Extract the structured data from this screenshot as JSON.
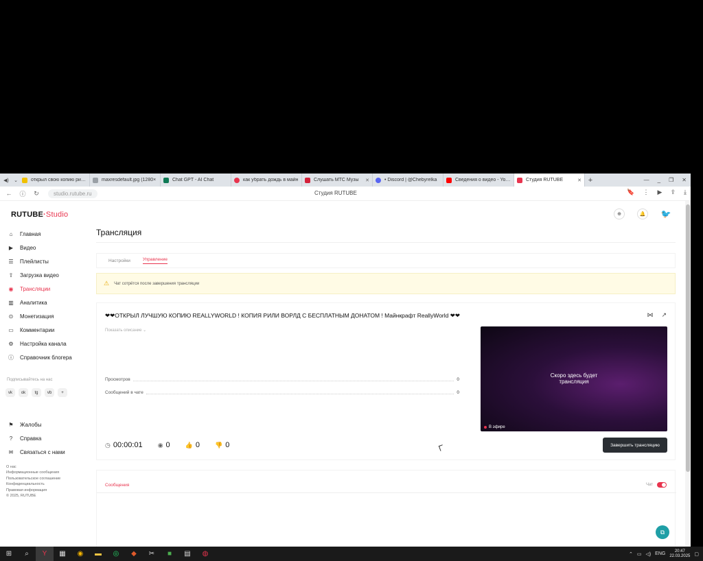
{
  "browser": {
    "tabs": [
      {
        "title": "открыл свою копию рилл",
        "color": "#f0c000"
      },
      {
        "title": "maxresdefault.jpg (1280×",
        "color": "#9aa0a6"
      },
      {
        "title": "Chat GPT - AI Chat",
        "color": "#0f7a55"
      },
      {
        "title": "как убрать дождь в майн",
        "color": "#e8344e"
      },
      {
        "title": "Слушать МТС Музы",
        "color": "#d4213a"
      },
      {
        "title": "• Discord | @Chebyrelka",
        "color": "#5865f2"
      },
      {
        "title": "Сведения о видео - YouT",
        "color": "#ff0000"
      },
      {
        "title": "Студия RUTUBE",
        "color": "#e8344e"
      }
    ],
    "url": "studio.rutube.ru",
    "page_title": "Студия RUTUBE"
  },
  "app": {
    "logo_main": "RUTUBE",
    "logo_studio": "Studio",
    "nav": [
      {
        "label": "Главная",
        "icon": "home-icon"
      },
      {
        "label": "Видео",
        "icon": "video-icon"
      },
      {
        "label": "Плейлисты",
        "icon": "playlist-icon"
      },
      {
        "label": "Загрузка видео",
        "icon": "upload-icon"
      },
      {
        "label": "Трансляции",
        "icon": "broadcast-icon",
        "active": true
      },
      {
        "label": "Аналитика",
        "icon": "analytics-icon"
      },
      {
        "label": "Монетизация",
        "icon": "money-icon"
      },
      {
        "label": "Комментарии",
        "icon": "comment-icon"
      },
      {
        "label": "Настройка канала",
        "icon": "gear-icon"
      },
      {
        "label": "Справочник блогера",
        "icon": "info-icon"
      }
    ],
    "subscribe_label": "Подписывайтесь на нас",
    "socials": [
      "vk",
      "ok",
      "tg",
      "vb",
      "+"
    ],
    "nav2": [
      {
        "label": "Жалобы",
        "icon": "flag-icon"
      },
      {
        "label": "Справка",
        "icon": "help-icon"
      },
      {
        "label": "Связаться с нами",
        "icon": "mail-icon"
      }
    ],
    "footer": [
      "О нас",
      "Информационные сообщения",
      "Пользовательское соглашение",
      "Конфиденциальность",
      "Правовая информация",
      "© 2025, RUTUBE"
    ]
  },
  "page": {
    "title": "Трансляция",
    "tabs": [
      "Настройки",
      "Управление"
    ],
    "active_tab": 1,
    "alert": "Чат сотрётся после завершения трансляции",
    "stream": {
      "title": "❤❤ОТКРЫЛ ЛУЧШУЮ КОПИЮ REALLYWORLD ! КОПИЯ РИЛИ ВОРЛД С БЕСПЛАТНЫМ ДОНАТОМ ! Майнкрафт ReallyWorld ❤❤",
      "show_description": "Показать описание ⌄",
      "stats": [
        {
          "label": "Просмотров",
          "value": "0"
        },
        {
          "label": "Сообщений в чате",
          "value": "0"
        }
      ],
      "preview_line1": "Скоро здесь будет",
      "preview_line2": "трансляция",
      "live_label": "В эфире",
      "timer": "00:00:01",
      "viewers": "0",
      "likes": "0",
      "dislikes": "0",
      "end_button": "Завершить трансляцию"
    },
    "messages_tab": "Сообщения",
    "chat_label": "Чат"
  },
  "taskbar": {
    "lang": "ENG",
    "time": "20:47",
    "date": "22.03.2025"
  }
}
